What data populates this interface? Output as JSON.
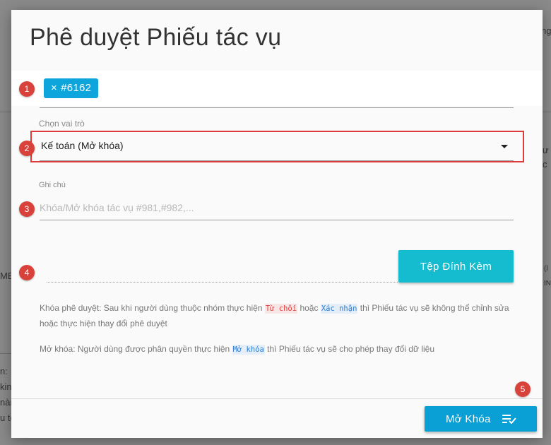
{
  "background": {
    "frag_topright": "ng",
    "frag_right1": "ư",
    "frag_right2": "c",
    "frag_right3": "(l",
    "frag_right4": "INI",
    "frag_left1": "ME",
    "frag_left2": "n:",
    "frag_left3": "kin",
    "frag_left4": "nàn",
    "frag_left5": "u tọ"
  },
  "dialog": {
    "title": "Phê duyệt Phiếu tác vụ",
    "ticket_chip": "#6162",
    "chip_remove_symbol": "×",
    "role_label": "Chọn vai trò",
    "role_value": "Kế toán (Mở khóa)",
    "note_label": "Ghi chú",
    "note_placeholder": "Khóa/Mở khóa tác vụ #981,#982,...",
    "attach_button": "Tệp Đính Kèm",
    "info_lock": {
      "prefix": "Khóa phê duyệt: Sau khi người dùng thuộc nhóm thực hiện",
      "reject": "Từ chối",
      "or": "hoặc",
      "confirm": "Xác nhận",
      "suffix": "thì Phiếu tác vụ sẽ không thể chỉnh sửa hoặc thực hiện thay đổi phê duyệt"
    },
    "info_unlock": {
      "prefix": "Mở khóa: Người dùng được phân quyền thực hiện",
      "unlock": "Mở khóa",
      "suffix": "thì Phiếu tác vụ sẽ cho phép thay đổi dữ liệu"
    },
    "unlock_button": "Mở Khóa"
  },
  "markers": [
    "1",
    "2",
    "3",
    "4",
    "5"
  ],
  "colors": {
    "accent": "#0aa0d6",
    "attach_button": "#15bccf",
    "marker": "#d9423a",
    "reject_text": "#e13c3c",
    "confirm_text": "#2b7bd6"
  },
  "icons": {
    "chip_remove": "close-icon",
    "dropdown": "caret-down-icon",
    "unlock_button": "playlist-check-icon"
  }
}
